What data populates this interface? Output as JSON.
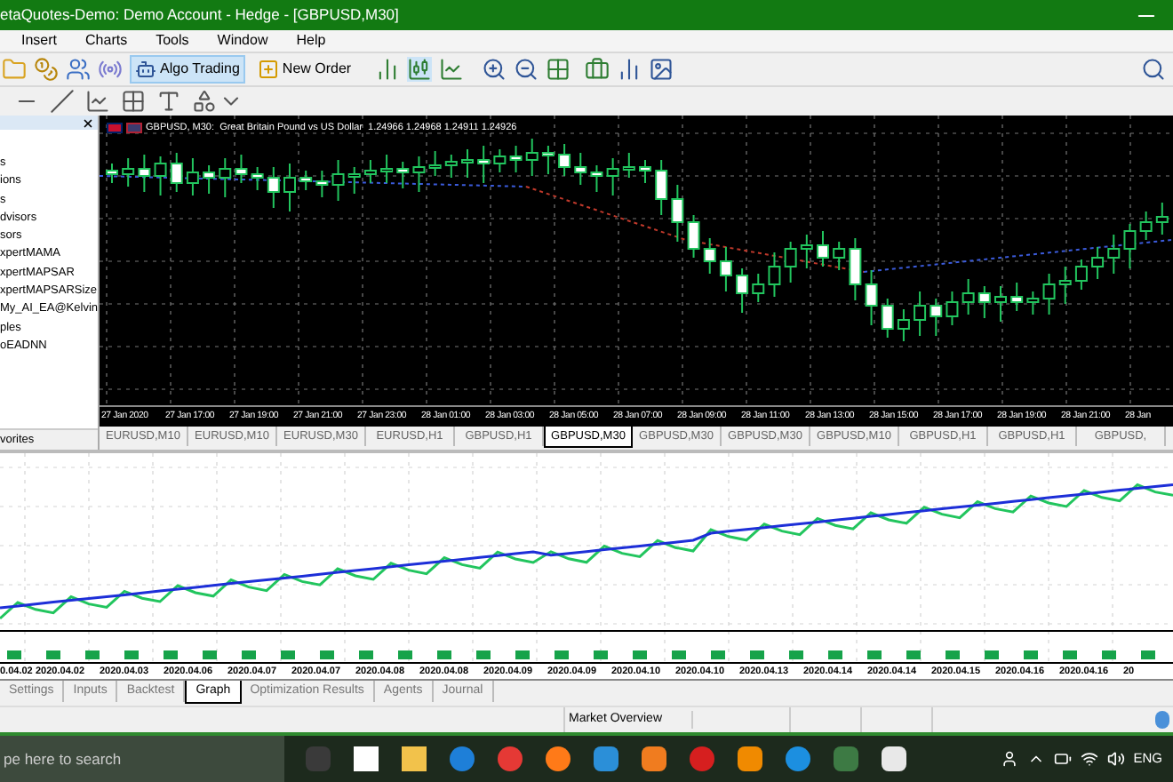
{
  "window": {
    "title": "etaQuotes-Demo: Demo Account - Hedge - [GBPUSD,M30]"
  },
  "menu": [
    "Insert",
    "Charts",
    "Tools",
    "Window",
    "Help"
  ],
  "toolbar": {
    "buttons": [
      {
        "label": "Algo Trading",
        "selected": true
      },
      {
        "label": "New Order",
        "selected": false
      }
    ]
  },
  "navigator": {
    "items": [
      "s",
      "ions",
      "s",
      "dvisors",
      "sors",
      "xpertMAMA",
      "xpertMAPSAR",
      "xpertMAPSARSize",
      "My_AI_EA@Kelvin",
      "ples",
      "oEADNN"
    ],
    "tab": "vorites"
  },
  "chart": {
    "header": "GBPUSD, M30:  Great Britain Pound vs US Dollar  1.24966 1.24968 1.24911 1.24926",
    "time_labels": [
      "27 Jan 2020",
      "27 Jan 17:00",
      "27 Jan 19:00",
      "27 Jan 21:00",
      "27 Jan 23:00",
      "28 Jan 01:00",
      "28 Jan 03:00",
      "28 Jan 05:00",
      "28 Jan 07:00",
      "28 Jan 09:00",
      "28 Jan 11:00",
      "28 Jan 13:00",
      "28 Jan 15:00",
      "28 Jan 17:00",
      "28 Jan 19:00",
      "28 Jan 21:00",
      "28 Jan"
    ]
  },
  "chart_tabs": [
    {
      "label": "EURUSD,M10",
      "selected": false
    },
    {
      "label": "EURUSD,M10",
      "selected": false
    },
    {
      "label": "EURUSD,M30",
      "selected": false
    },
    {
      "label": "EURUSD,H1",
      "selected": false
    },
    {
      "label": "GBPUSD,H1",
      "selected": false
    },
    {
      "label": "GBPUSD,M30",
      "selected": true
    },
    {
      "label": "GBPUSD,M30",
      "selected": false
    },
    {
      "label": "GBPUSD,M30",
      "selected": false
    },
    {
      "label": "GBPUSD,M10",
      "selected": false
    },
    {
      "label": "GBPUSD,H1",
      "selected": false
    },
    {
      "label": "GBPUSD,H1",
      "selected": false
    },
    {
      "label": "GBPUSD,",
      "selected": false
    }
  ],
  "graph": {
    "date_labels": [
      "0.04.02",
      "2020.04.02",
      "2020.04.03",
      "2020.04.06",
      "2020.04.07",
      "2020.04.07",
      "2020.04.08",
      "2020.04.08",
      "2020.04.09",
      "2020.04.09",
      "2020.04.10",
      "2020.04.10",
      "2020.04.13",
      "2020.04.14",
      "2020.04.14",
      "2020.04.15",
      "2020.04.16",
      "2020.04.16",
      "20"
    ]
  },
  "tester_tabs": [
    {
      "label": "Settings",
      "selected": false
    },
    {
      "label": "Inputs",
      "selected": false
    },
    {
      "label": "Backtest",
      "selected": false
    },
    {
      "label": "Graph",
      "selected": true
    },
    {
      "label": "Optimization Results",
      "selected": false
    },
    {
      "label": "Agents",
      "selected": false
    },
    {
      "label": "Journal",
      "selected": false
    }
  ],
  "status_bar": {
    "label": "Market Overview"
  },
  "taskbar": {
    "search_placeholder": "pe here to search",
    "language": "ENG"
  }
}
